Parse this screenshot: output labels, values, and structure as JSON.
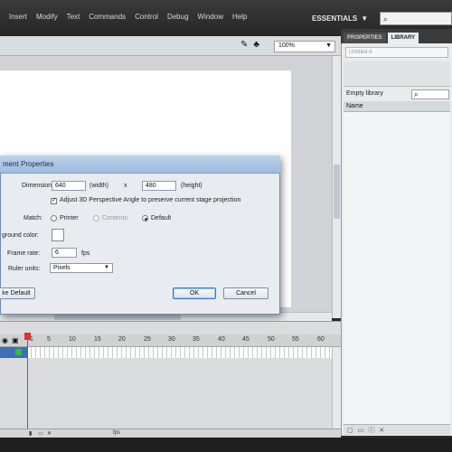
{
  "menubar": {
    "items": [
      "Insert",
      "Modify",
      "Text",
      "Commands",
      "Control",
      "Debug",
      "Window",
      "Help"
    ],
    "workspace": "ESSENTIALS",
    "workspace_arrow": "▼"
  },
  "editbar": {
    "zoom": "100%"
  },
  "panel": {
    "tabs": [
      "PROPERTIES",
      "LIBRARY"
    ],
    "document_field": "Untitled-6",
    "empty_library": "Empty library",
    "column_name": "Name"
  },
  "dialog": {
    "title": "ment Properties",
    "dimensions_label": "Dimensions:",
    "width_value": "640",
    "width_label": "(width)",
    "times": "x",
    "height_value": "480",
    "height_label": "(height)",
    "adjust_3d_label": "Adjust 3D Perspective Angle to preserve current stage projection",
    "match_label": "Match:",
    "match_options": [
      "Printer",
      "Contents",
      "Default"
    ],
    "match_selected": "Default",
    "background_label": "ground color:",
    "frame_rate_label": "Frame rate:",
    "frame_rate_value": "6",
    "fps_label": "fps",
    "ruler_units_label": "Ruler units:",
    "ruler_units_value": "Pixels",
    "make_default_label": "ke Default",
    "ok_label": "OK",
    "cancel_label": "Cancel"
  },
  "timeline": {
    "ticks": [
      "1",
      "5",
      "10",
      "15",
      "20",
      "25",
      "30",
      "35",
      "40",
      "45",
      "50",
      "55",
      "60"
    ],
    "footer_fps": "fps"
  }
}
